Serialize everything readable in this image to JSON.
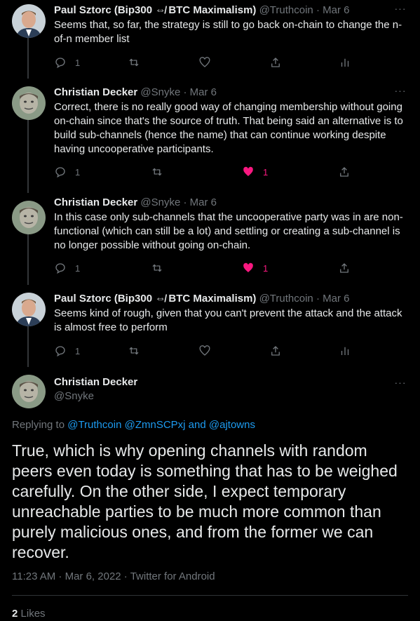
{
  "tweets": [
    {
      "name": "Paul Sztorc (Bip300 ⇎ BTC Maximalism)",
      "handle": "@Truthcoin",
      "sep": "·",
      "date": "Mar 6",
      "text": "Seems that, so far, the strategy is still to go back on-chain to change the n-of-n member list",
      "reply_count": "1",
      "like_count": "",
      "liked": false
    },
    {
      "name": "Christian Decker",
      "handle": "@Snyke",
      "sep": "·",
      "date": "Mar 6",
      "text": "Correct, there is no really good way of changing membership without going on-chain since that's the source of truth. That being said an alternative is to build sub-channels (hence the name) that can continue working despite having uncooperative participants.",
      "reply_count": "1",
      "like_count": "1",
      "liked": true
    },
    {
      "name": "Christian Decker",
      "handle": "@Snyke",
      "sep": "·",
      "date": "Mar 6",
      "text": "In this case only sub-channels that the uncooperative party was in are non-functional (which can still be a lot) and settling or creating a sub-channel is no longer possible without going on-chain.",
      "reply_count": "1",
      "like_count": "1",
      "liked": true
    },
    {
      "name": "Paul Sztorc (Bip300 ⇎ BTC Maximalism)",
      "handle": "@Truthcoin",
      "sep": "·",
      "date": "Mar 6",
      "text": "Seems kind of rough, given that you can't prevent the attack and the attack is almost free to perform",
      "reply_count": "1",
      "like_count": "",
      "liked": false
    }
  ],
  "main": {
    "name": "Christian Decker",
    "handle": "@Snyke",
    "replying_prefix": "Replying to",
    "replying_1": "@Truthcoin",
    "replying_2": "@ZmnSCPxj",
    "replying_and": "and",
    "replying_3": "@ajtowns",
    "text": "True, which is why opening channels with random peers even today is something that has to be weighed carefully. On the other side, I expect temporary unreachable parties to be much more common than purely malicious ones, and from the former we can recover.",
    "timestamp": "11:23 AM · Mar 6, 2022 · Twitter for Android",
    "likes_count": "2",
    "likes_label": "Likes"
  },
  "more_glyph": "···",
  "colors": {
    "background": "#000000",
    "text": "#e7e9ea",
    "muted": "#71767b",
    "link": "#1d9bf0",
    "like": "#f91880"
  }
}
